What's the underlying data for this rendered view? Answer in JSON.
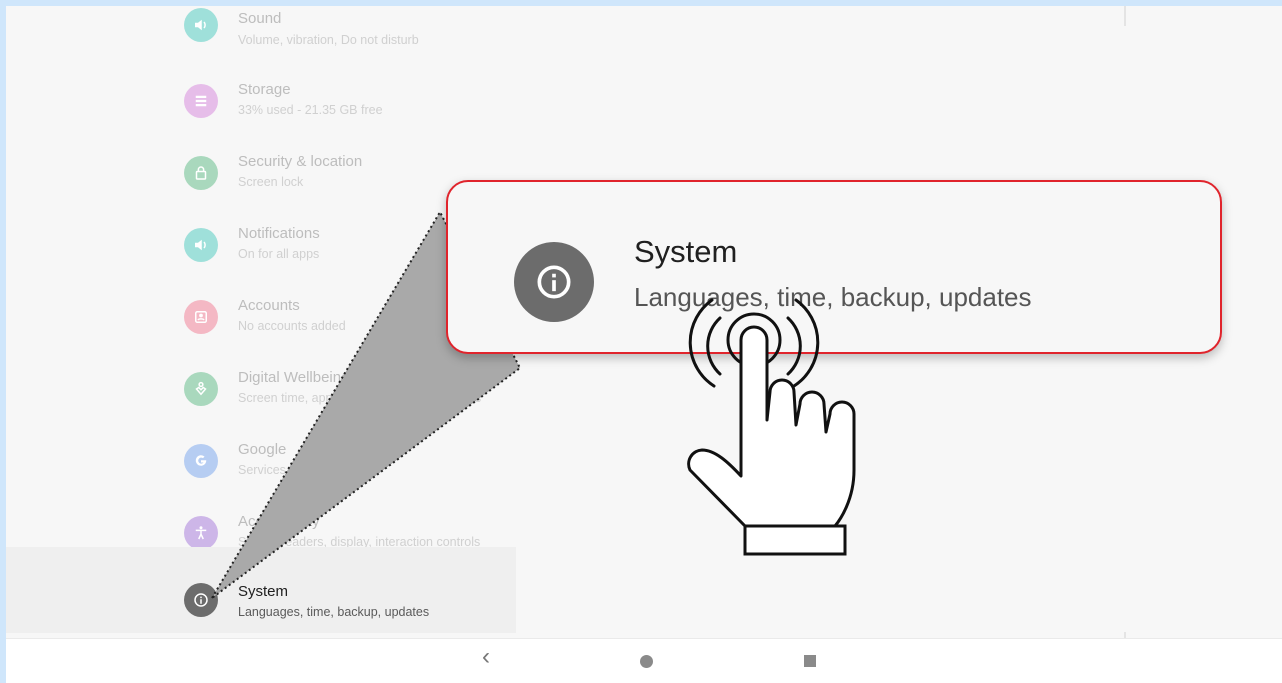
{
  "settings": {
    "items": [
      {
        "title": "Sound",
        "subtitle": "Volume, vibration, Do not disturb",
        "icon": "volume-icon",
        "color": "#9fe0da"
      },
      {
        "title": "Storage",
        "subtitle": "33% used - 21.35 GB free",
        "icon": "storage-icon",
        "color": "#e6bde9"
      },
      {
        "title": "Security & location",
        "subtitle": "Screen lock",
        "icon": "lock-icon",
        "color": "#a9d8bd"
      },
      {
        "title": "Notifications",
        "subtitle": "On for all apps",
        "icon": "notifications-icon",
        "color": "#9fe0da"
      },
      {
        "title": "Accounts",
        "subtitle": "No accounts added",
        "icon": "account-icon",
        "color": "#f4b8c4"
      },
      {
        "title": "Digital Wellbeing & parental controls",
        "subtitle": "Screen time, app timers, bedtime schedules",
        "icon": "wellbeing-icon",
        "color": "#a9d8bd"
      },
      {
        "title": "Google",
        "subtitle": "Services & preferences",
        "icon": "google-icon",
        "color": "#b6cdf2"
      },
      {
        "title": "Accessibility",
        "subtitle": "Screen readers, display, interaction controls",
        "icon": "accessibility-icon",
        "color": "#cdb6e8"
      },
      {
        "title": "System",
        "subtitle": "Languages, time, backup, updates",
        "icon": "info-icon",
        "color": "#6c6c6c"
      }
    ]
  },
  "callout": {
    "title": "System",
    "subtitle": "Languages, time, backup, updates",
    "icon": "info-icon",
    "border_color": "#e0242c"
  },
  "navbar": {
    "back_symbol": "‹",
    "home_icon": "home-circle-icon",
    "recents_icon": "recents-square-icon"
  },
  "pointer": {
    "icon": "tap-hand-icon"
  }
}
